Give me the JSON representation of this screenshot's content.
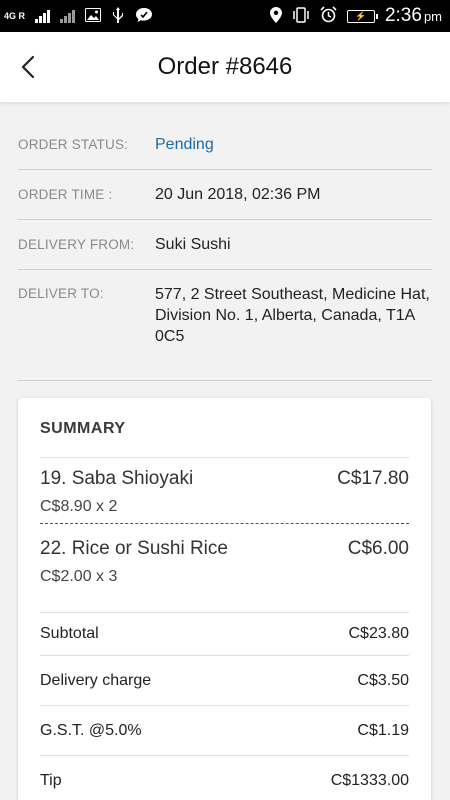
{
  "status_bar": {
    "network": "4G R",
    "time": "2:36",
    "ampm": "pm",
    "icons": [
      "signal-icon",
      "signal-icon",
      "image-icon",
      "usb-icon",
      "chat-icon",
      "location-icon",
      "vibrate-icon",
      "alarm-icon",
      "battery-icon"
    ]
  },
  "header": {
    "title": "Order #8646",
    "back_icon": "chevron-left-icon"
  },
  "order_info": {
    "status_label": "ORDER STATUS:",
    "status_value": "Pending",
    "time_label": "ORDER TIME :",
    "time_value": "20 Jun 2018, 02:36 PM",
    "from_label": "DELIVERY FROM:",
    "from_value": "Suki Sushi",
    "to_label": "DELIVER TO:",
    "to_value": "577, 2 Street Southeast, Medicine Hat, Division No. 1, Alberta, Canada, T1A 0C5"
  },
  "summary": {
    "title": "SUMMARY",
    "items": [
      {
        "name": "19. Saba Shioyaki",
        "price": "C$17.80",
        "detail": "C$8.90  x 2"
      },
      {
        "name": "22. Rice or Sushi Rice",
        "price": "C$6.00",
        "detail": "C$2.00  x 3"
      }
    ],
    "lines": [
      {
        "label": "Subtotal",
        "value": "C$23.80"
      },
      {
        "label": "Delivery charge",
        "value": "C$3.50"
      },
      {
        "label": "G.S.T. @5.0%",
        "value": "C$1.19"
      },
      {
        "label": "Tip",
        "value": "C$1333.00"
      }
    ]
  },
  "colors": {
    "accent": "#1a6aa8",
    "background": "#f2f2f2",
    "status_bar": "#000000"
  }
}
